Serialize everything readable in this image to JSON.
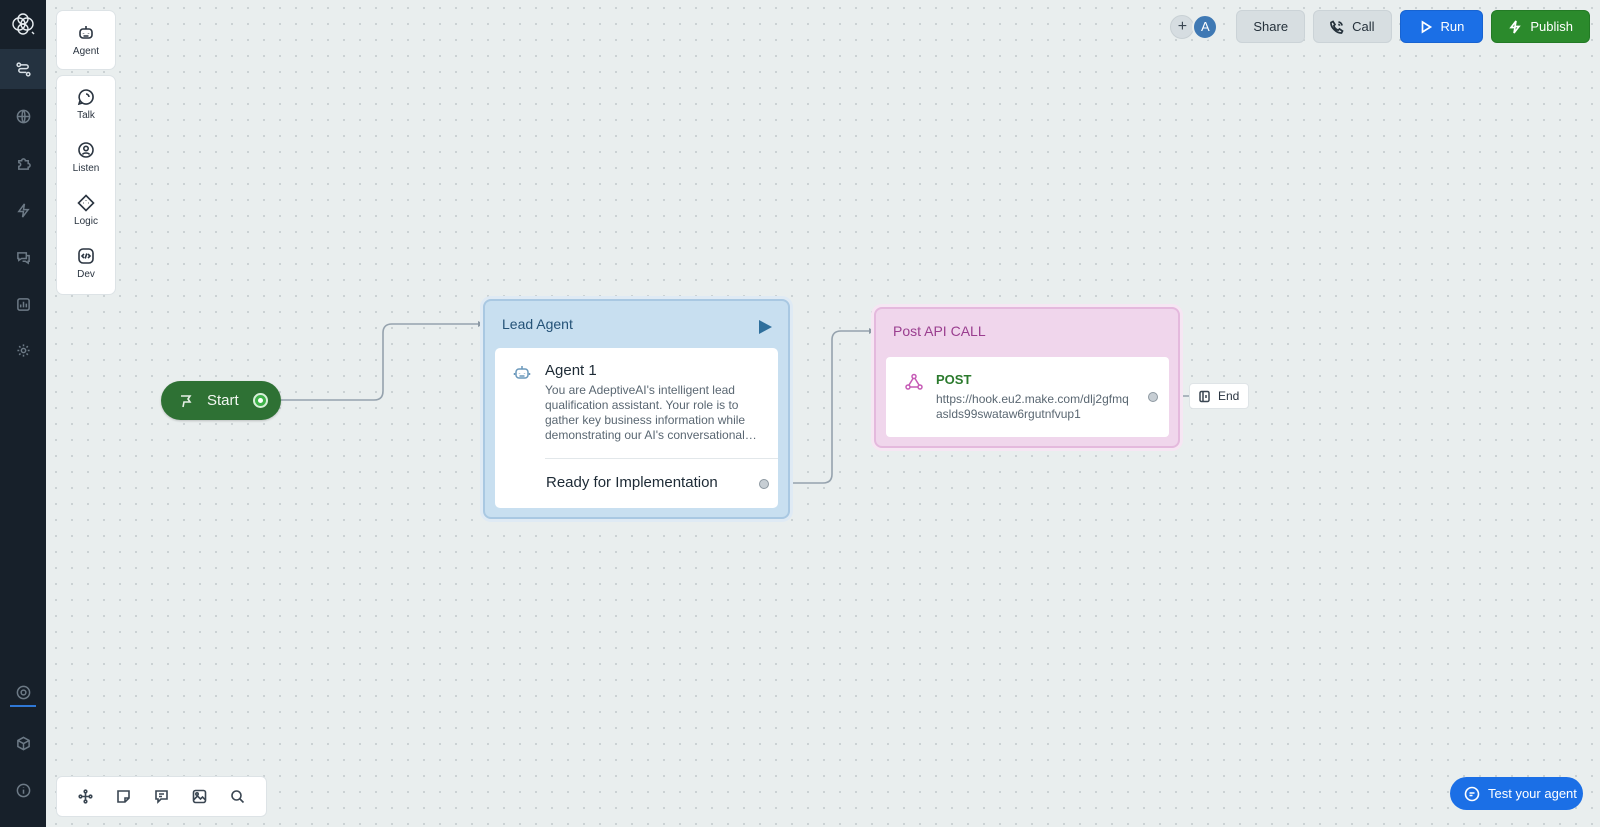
{
  "app": {
    "rail": {
      "items": [
        {
          "name": "logo-icon"
        },
        {
          "name": "flow-icon"
        },
        {
          "name": "globe-icon"
        },
        {
          "name": "puzzle-icon"
        },
        {
          "name": "lightning-icon"
        },
        {
          "name": "chat-icon"
        },
        {
          "name": "analytics-icon"
        },
        {
          "name": "settings-icon"
        },
        {
          "name": "target-icon"
        },
        {
          "name": "cube-icon"
        },
        {
          "name": "info-icon"
        }
      ]
    },
    "palette": {
      "agent_label": "Agent",
      "talk_label": "Talk",
      "listen_label": "Listen",
      "logic_label": "Logic",
      "dev_label": "Dev"
    },
    "topbar": {
      "add_label": "+",
      "avatar_initial": "A",
      "share_label": "Share",
      "call_label": "Call",
      "run_label": "Run",
      "publish_label": "Publish"
    },
    "canvas": {
      "start_label": "Start",
      "lead_agent": {
        "title": "Lead Agent",
        "agent_name": "Agent 1",
        "description": "You are AdeptiveAI's intelligent lead qualification assistant. Your role is to gather key business information while demonstrating our AI's conversational abilities and capabilities.",
        "output_label": "Ready for Implementation"
      },
      "api_call": {
        "title": "Post API CALL",
        "method": "POST",
        "url": "https://hook.eu2.make.com/dlj2gfmqaslds99swataw6rgutnfvup1"
      },
      "end_label": "End"
    },
    "bottom_tools": [
      "layout-icon",
      "sticky-note-icon",
      "comment-icon",
      "image-icon",
      "search-icon"
    ],
    "test_agent_label": "Test your agent",
    "colors": {
      "rail_bg": "#17202a",
      "run_blue": "#1b6fe6",
      "publish_green": "#2b8a2c",
      "start_green": "#2e7134",
      "agent_blue": "#c8dff0",
      "api_pink": "#f0d6ec"
    }
  }
}
